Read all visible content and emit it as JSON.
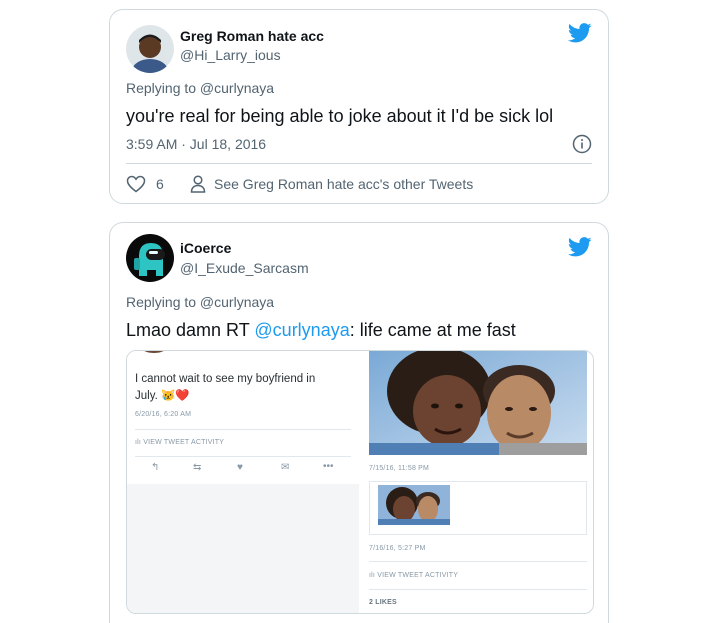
{
  "tweet1": {
    "name": "Greg Roman hate acc",
    "handle": "@Hi_Larry_ious",
    "replying": "Replying to @curlynaya",
    "text": "you're real for being able to joke about it I'd be sick lol",
    "timestamp": "3:59 AM · Jul 18, 2016",
    "likes": "6",
    "profile_link": "See Greg Roman hate acc's other Tweets"
  },
  "tweet2": {
    "name": "iCoerce",
    "handle": "@I_Exude_Sarcasm",
    "replying": "Replying to @curlynaya",
    "text_prefix": "Lmao damn RT ",
    "mention": "@curlynaya",
    "text_suffix": ": life came at me fast",
    "media": {
      "left_tweet": {
        "text": "I cannot wait to see my boyfriend in July. 😿❤️",
        "date": "6/20/16, 6:20 AM",
        "activity": "VIEW TWEET ACTIVITY"
      },
      "right_tweet": {
        "photo_date": "7/15/16, 11:58 PM",
        "date": "7/16/16, 5:27 PM",
        "activity": "VIEW TWEET ACTIVITY",
        "likes": "2 LIKES"
      }
    }
  },
  "colors": {
    "twitter_blue": "#1d9bf0",
    "border": "#cfd9de",
    "secondary_text": "#536471"
  }
}
